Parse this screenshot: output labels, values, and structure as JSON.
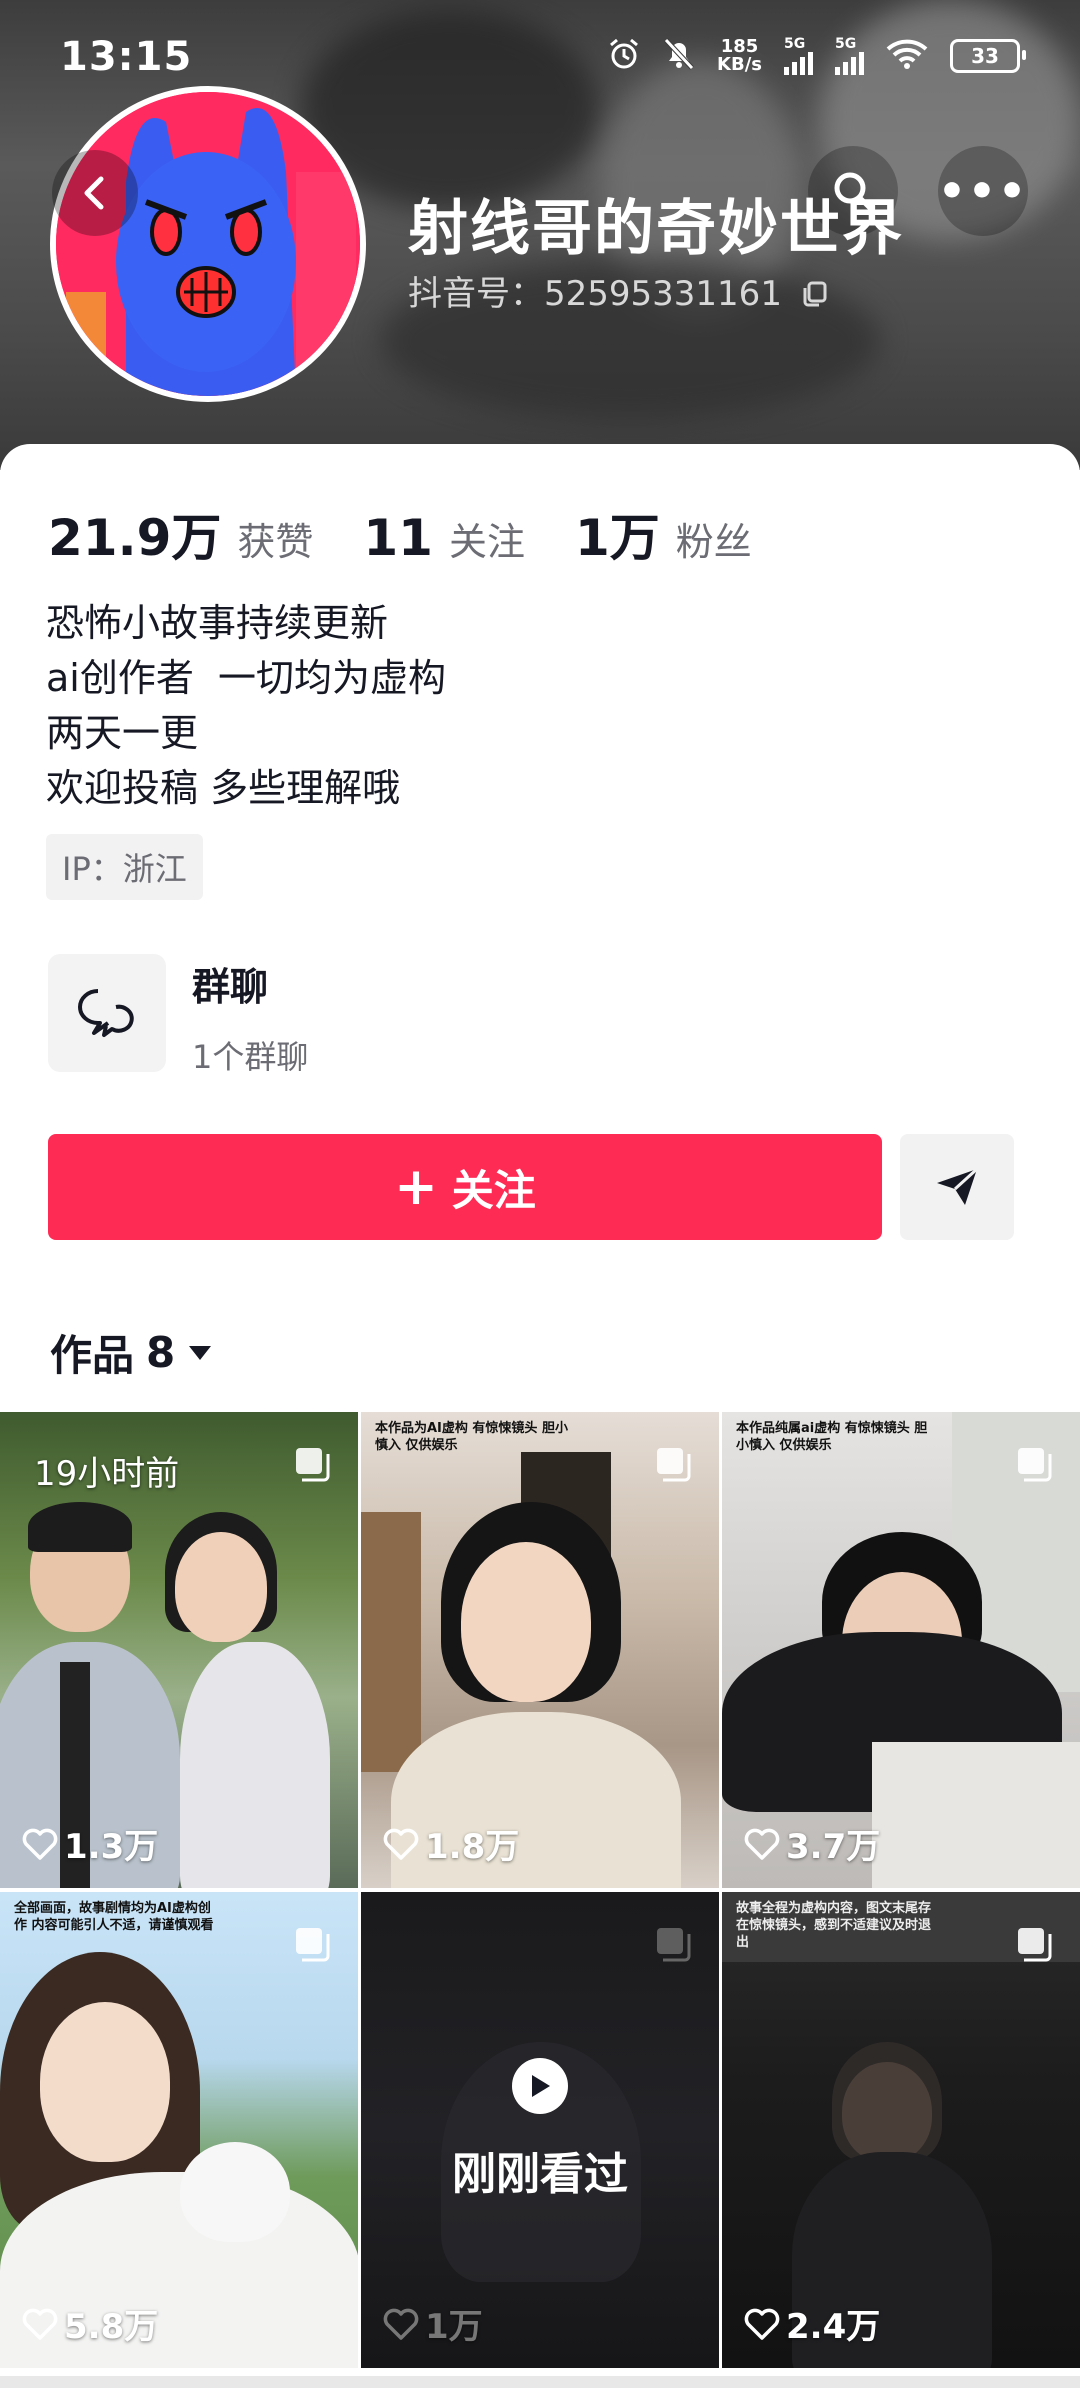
{
  "status_bar": {
    "time": "13:15",
    "net_speed_top": "185",
    "net_speed_unit": "KB/s",
    "sim1": "5G",
    "sim2": "5G",
    "battery": "33"
  },
  "profile": {
    "display_name": "射线哥的奇妙世界",
    "douyin_id_label": "抖音号：",
    "douyin_id": "52595331161",
    "stats": [
      {
        "value": "21.9万",
        "label": "获赞"
      },
      {
        "value": "11",
        "label": "关注"
      },
      {
        "value": "1万",
        "label": "粉丝"
      }
    ],
    "bio_lines": [
      "恐怖小故事持续更新",
      "ai创作者  一切均为虚构",
      "两天一更",
      "欢迎投稿 多些理解哦"
    ],
    "ip": "IP：浙江"
  },
  "group_chat": {
    "title": "群聊",
    "subtitle": "1个群聊"
  },
  "actions": {
    "follow_label": "关注",
    "follow_plus": "+"
  },
  "works": {
    "tab_label": "作品",
    "count": "8"
  },
  "videos": [
    {
      "caption": "",
      "time_label": "19小时前",
      "likes": "1.3万"
    },
    {
      "caption": "本作品为AI虚构 有惊悚镜头 胆小慎入 仅供娱乐",
      "likes": "1.8万"
    },
    {
      "caption": "本作品纯属ai虚构 有惊悚镜头 胆小慎入 仅供娱乐",
      "likes": "3.7万"
    },
    {
      "caption": "全部画面，故事剧情均为AI虚构创作 内容可能引人不适，请谨慎观看",
      "likes": "5.8万"
    },
    {
      "caption": "",
      "overlay": "刚刚看过",
      "likes": "1万"
    },
    {
      "caption": "故事全程为虚构内容，图文末尾存在惊悚镜头，感到不适建议及时退出",
      "likes": "2.4万"
    }
  ],
  "colors": {
    "accent": "#fe2c55",
    "text_primary": "#161823",
    "text_secondary": "#6c6c74"
  }
}
